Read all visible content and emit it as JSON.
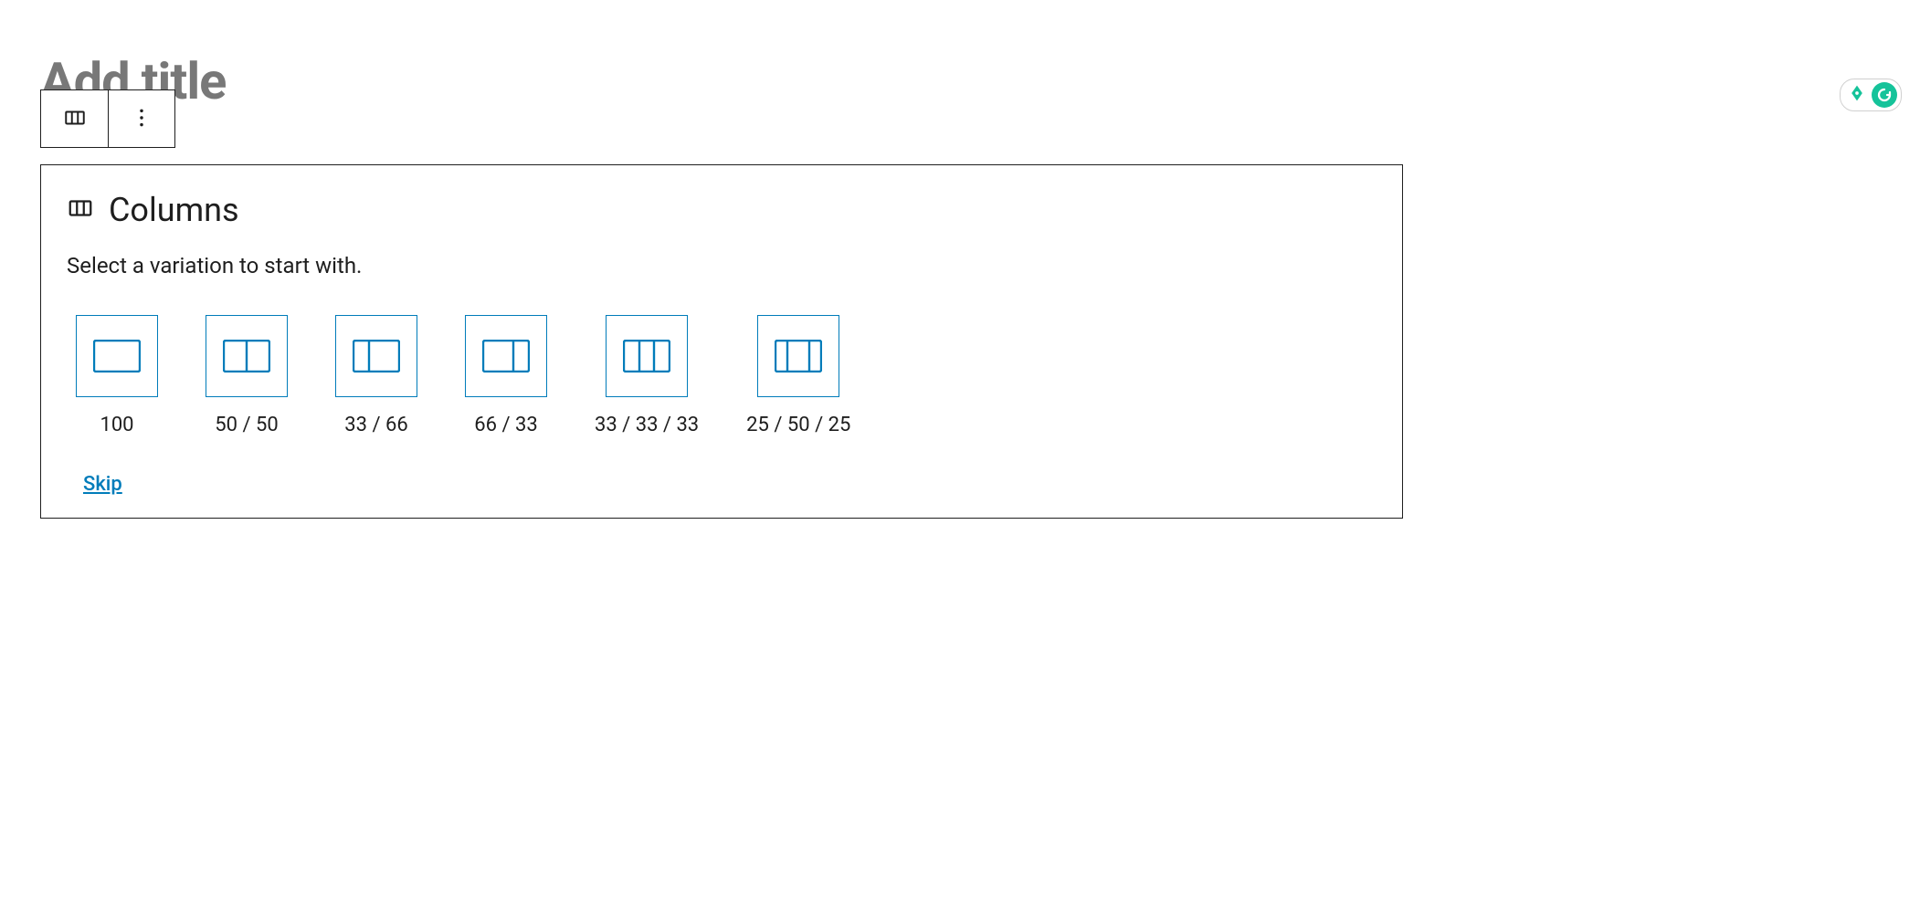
{
  "page_title_placeholder": "Add title",
  "columns_block": {
    "title": "Columns",
    "description": "Select a variation to start with.",
    "variations": [
      {
        "label": "100"
      },
      {
        "label": "50 / 50"
      },
      {
        "label": "33 / 66"
      },
      {
        "label": "66 / 33"
      },
      {
        "label": "33 / 33 / 33"
      },
      {
        "label": "25 / 50 / 25"
      }
    ],
    "skip_label": "Skip"
  },
  "colors": {
    "accent": "#007cba",
    "grammarly": "#15c39a"
  }
}
